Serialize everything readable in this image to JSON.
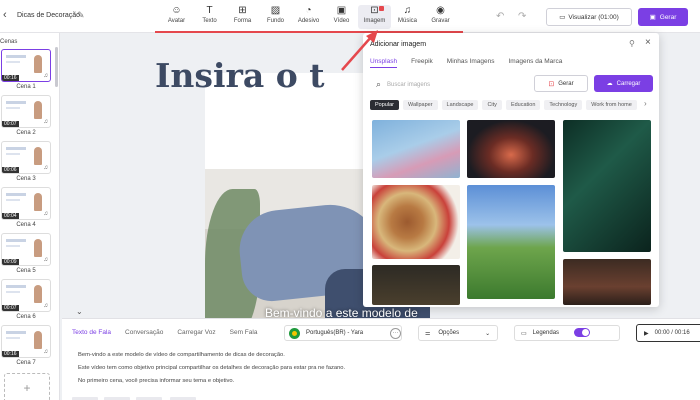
{
  "app": {
    "project_title": "Dicas de Decoração"
  },
  "toolbar": {
    "tools": [
      {
        "label": "Avatar",
        "icon": "avatar-icon"
      },
      {
        "label": "Texto",
        "icon": "text-icon"
      },
      {
        "label": "Forma",
        "icon": "shape-icon"
      },
      {
        "label": "Fundo",
        "icon": "background-icon"
      },
      {
        "label": "Adesivo",
        "icon": "sticker-icon"
      },
      {
        "label": "Vídeo",
        "icon": "video-icon"
      },
      {
        "label": "Imagem",
        "icon": "image-icon"
      },
      {
        "label": "Música",
        "icon": "music-icon"
      },
      {
        "label": "Gravar",
        "icon": "record-icon"
      }
    ],
    "active_tool": "Imagem",
    "preview_label": "Visualizar (01:00)",
    "generate_label": "Gerar",
    "accent_color": "#7b3fe4",
    "highlight_color": "#e5484d"
  },
  "scenes_panel": {
    "header": "Cenas",
    "scenes": [
      {
        "label": "Cena 1",
        "duration": "00:16"
      },
      {
        "label": "Cena 2",
        "duration": "00:07"
      },
      {
        "label": "Cena 3",
        "duration": "00:06"
      },
      {
        "label": "Cena 4",
        "duration": "00:04"
      },
      {
        "label": "Cena 5",
        "duration": "00:09"
      },
      {
        "label": "Cena 6",
        "duration": "00:07"
      },
      {
        "label": "Cena 7",
        "duration": "00:16"
      }
    ],
    "selected": 0
  },
  "canvas": {
    "title": "Insira o t",
    "caption": "Bem-vindo a este modelo de"
  },
  "image_panel": {
    "title": "Adicionar imagem",
    "tabs": [
      "Unsplash",
      "Freepik",
      "Minhas Imagens",
      "Imagens da Marca"
    ],
    "active_tab": "Unsplash",
    "search_placeholder": "Buscar imagens",
    "ai_generate_label": "Gerar",
    "upload_label": "Carregar",
    "categories": [
      "Popular",
      "Wallpaper",
      "Landscape",
      "City",
      "Education",
      "Technology",
      "Work from home"
    ],
    "active_category": "Popular"
  },
  "script_panel": {
    "tabs": [
      "Texto de Fala",
      "Conversação",
      "Carregar Voz",
      "Sem Fala"
    ],
    "active_tab": "Texto de Fala",
    "voice": "Português(BR) - Yara",
    "options_label": "Opções",
    "captions_label": "Legendas",
    "captions_on": true,
    "play_time": "00:00 / 00:16",
    "lines": [
      "Bem-vindo a este modelo de vídeo de compartilhamento de dicas de decoração.",
      "Este vídeo tem como objetivo principal compartilhar os detalhes de decoração para estar pra ne fazano.",
      "No primeiro cena, você precisa informar seu tema e objetivo."
    ]
  }
}
